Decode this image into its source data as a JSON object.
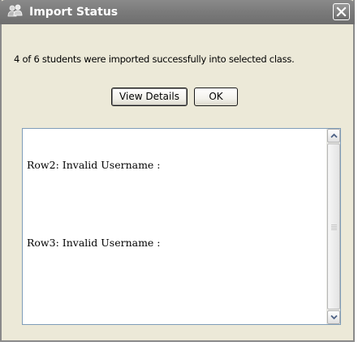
{
  "window": {
    "title": "Import Status",
    "app_icon": "people-icon",
    "close_icon": "close-icon"
  },
  "message": "4 of 6 students were imported successfully into selected class.",
  "buttons": {
    "view_details": "View Details",
    "ok": "OK"
  },
  "log": {
    "lines": [
      "Row2: Invalid Username :",
      "",
      "Row3: Invalid Username :"
    ]
  },
  "scrollbar": {
    "up_icon": "chevron-up-icon",
    "down_icon": "chevron-down-icon"
  },
  "colors": {
    "titlebar": "#7a7a7a",
    "dialog_bg": "#ece9d8",
    "log_border": "#7f9db9"
  }
}
